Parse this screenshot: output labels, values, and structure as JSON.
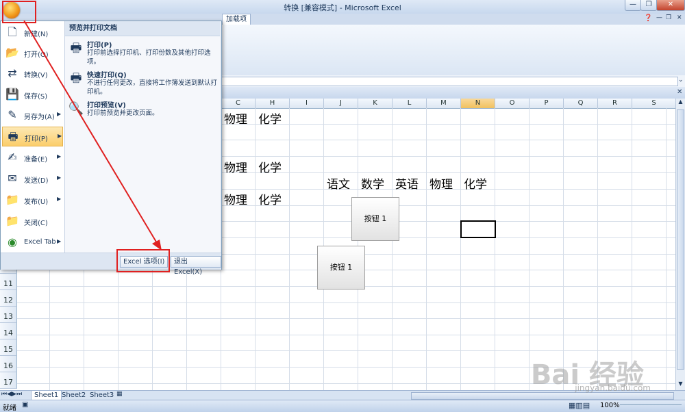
{
  "window": {
    "title": "转换 [兼容模式] - Microsoft Excel",
    "controls": [
      "—",
      "❐",
      "✕"
    ]
  },
  "ribbon": {
    "visible_tab": "加载项"
  },
  "grid": {
    "columns": [
      "C",
      "H",
      "I",
      "J",
      "K",
      "L",
      "M",
      "N",
      "O",
      "P",
      "Q",
      "R",
      "S"
    ],
    "selected_column": "N",
    "rows": [
      "11",
      "12",
      "13",
      "14",
      "15",
      "16",
      "17"
    ],
    "cells": {
      "r1_g": "物理",
      "r1_h": "化学",
      "r4_g": "物理",
      "r4_h": "化学",
      "r5_j": "语文",
      "r5_k": "数学",
      "r5_l": "英语",
      "r5_m": "物理",
      "r5_n": "化学",
      "r6_g": "物理",
      "r6_h": "化学"
    },
    "buttons": [
      "按钮 1",
      "按钮 1"
    ]
  },
  "sheets": [
    "Sheet1",
    "Sheet2",
    "Sheet3"
  ],
  "status": {
    "ready": "就绪",
    "zoom": "100%"
  },
  "office_menu": {
    "items": [
      {
        "label": "新建(N)",
        "icon": "new-document-icon",
        "arrow": false
      },
      {
        "label": "打开(O)",
        "icon": "open-folder-icon",
        "arrow": false
      },
      {
        "label": "转换(V)",
        "icon": "convert-icon",
        "arrow": false
      },
      {
        "label": "保存(S)",
        "icon": "save-icon",
        "arrow": false
      },
      {
        "label": "另存为(A)",
        "icon": "save-as-icon",
        "arrow": true
      },
      {
        "label": "打印(P)",
        "icon": "printer-icon",
        "arrow": true
      },
      {
        "label": "准备(E)",
        "icon": "prepare-icon",
        "arrow": true
      },
      {
        "label": "发送(D)",
        "icon": "send-icon",
        "arrow": true
      },
      {
        "label": "发布(U)",
        "icon": "publish-icon",
        "arrow": true
      },
      {
        "label": "关闭(C)",
        "icon": "close-folder-icon",
        "arrow": false
      },
      {
        "label": "Excel Tab",
        "icon": "excel-tab-icon",
        "arrow": true
      }
    ],
    "active_item": "打印(P)",
    "submenu": {
      "header": "预览并打印文档",
      "entries": [
        {
          "title": "打印(P)",
          "desc": "打印前选择打印机、打印份数及其他打印选项。"
        },
        {
          "title": "快速打印(Q)",
          "desc": "不进行任何更改，直接将工作簿发送到默认打印机。"
        },
        {
          "title": "打印预览(V)",
          "desc": "打印前预览并更改页面。"
        }
      ]
    },
    "footer": {
      "options_label": "Excel 选项(I)",
      "exit_label": "退出 Excel(X)"
    }
  },
  "watermark": {
    "brand": "Bai 经验",
    "url": "jingyan.baidu.com"
  }
}
